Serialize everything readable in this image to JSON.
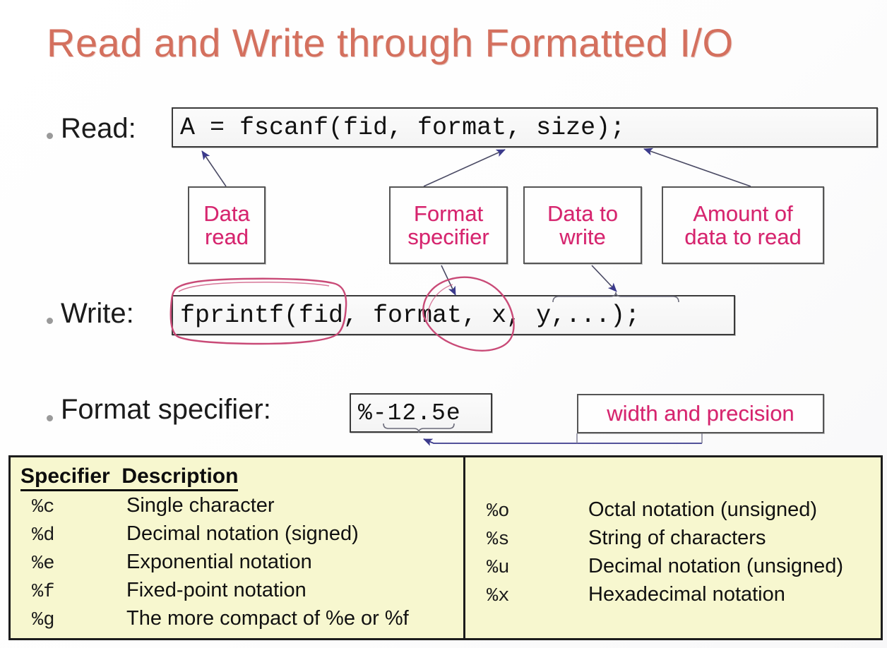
{
  "slide": {
    "title": "Read and Write through Formatted I/O",
    "title_color": "#d4705e",
    "background": "#ffffff"
  },
  "rows": {
    "read": {
      "label": "Read:",
      "code": "A = fscanf(fid, format, size);"
    },
    "write": {
      "label": "Write:",
      "code": "fprintf(fid, format, x, y,...);"
    },
    "format_specifier": {
      "label": "Format specifier:",
      "code": "%-12.5e"
    }
  },
  "callouts": [
    {
      "id": "data-read",
      "lines": [
        "Data",
        "read"
      ],
      "color": "#d6246e"
    },
    {
      "id": "format-specifier",
      "lines": [
        "Format",
        "specifier"
      ],
      "color": "#d6246e"
    },
    {
      "id": "data-to-write",
      "lines": [
        "Data to",
        "write"
      ],
      "color": "#d6246e"
    },
    {
      "id": "amount-of-data-to-read",
      "lines": [
        "Amount of",
        "data to read"
      ],
      "color": "#d6246e"
    },
    {
      "id": "width-and-precision",
      "lines": [
        "width and precision"
      ],
      "color": "#d6246e"
    }
  ],
  "annotations": {
    "arrow_color": "#3b3a8c",
    "ink_color": "#c94a77",
    "ink_shapes": [
      "oval-around-fprintf-fid",
      "oval-around-format"
    ]
  },
  "spec_table": {
    "background": "#f7f7cf",
    "border_color": "#1c1c1c",
    "headers": [
      "Specifier",
      "Description"
    ],
    "left_rows": [
      {
        "specifier": "%c",
        "description": "Single character"
      },
      {
        "specifier": "%d",
        "description": "Decimal notation (signed)"
      },
      {
        "specifier": "%e",
        "description": "Exponential notation"
      },
      {
        "specifier": "%f",
        "description": "Fixed-point notation"
      },
      {
        "specifier": "%g",
        "description": "The more compact of %e or %f"
      }
    ],
    "right_rows": [
      {
        "specifier": "%o",
        "description": "Octal notation (unsigned)"
      },
      {
        "specifier": "%s",
        "description": "String of characters"
      },
      {
        "specifier": "%u",
        "description": "Decimal notation (unsigned)"
      },
      {
        "specifier": "%x",
        "description": "Hexadecimal notation"
      }
    ]
  }
}
